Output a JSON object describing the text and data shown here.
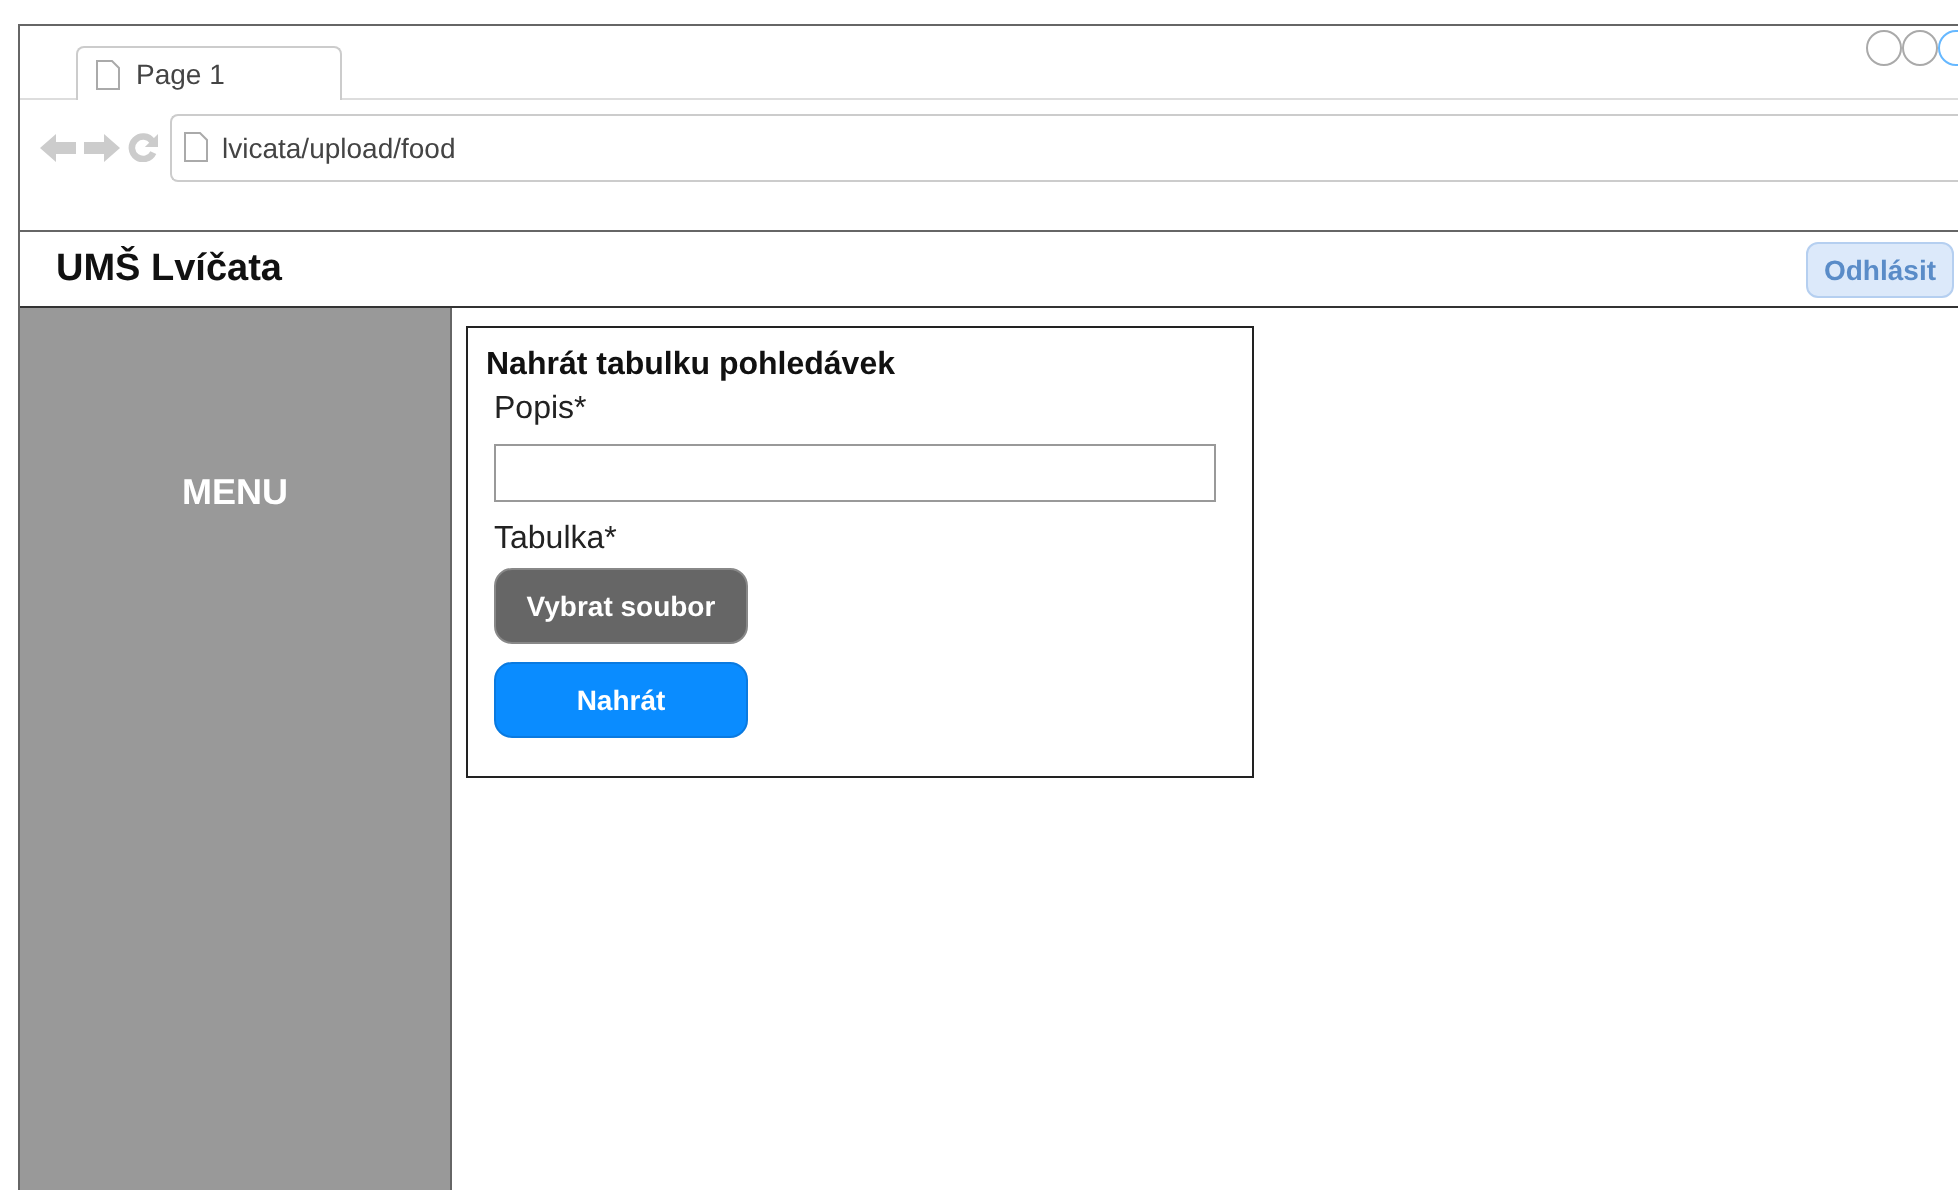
{
  "browser": {
    "tab": {
      "label": "Page 1"
    },
    "address": "lvicata/upload/food"
  },
  "header": {
    "title": "UMŠ Lvíčata",
    "logout": {
      "label": "Odhlásit",
      "disabled": true
    }
  },
  "sidebar": {
    "label": "MENU"
  },
  "form": {
    "title": "Nahrát tabulku pohledávek",
    "fields": [
      {
        "kind": "text",
        "label": "Popis*"
      },
      {
        "kind": "file",
        "label": "Tabulka*",
        "button": "Vybrat soubor"
      }
    ],
    "submit": "Nahrát"
  }
}
